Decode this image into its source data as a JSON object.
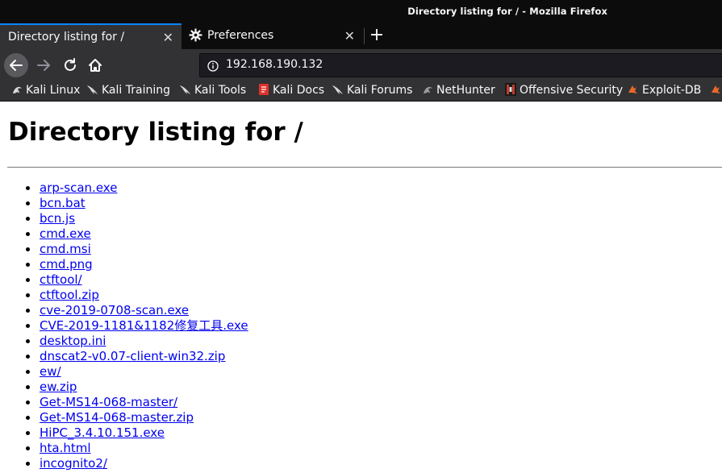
{
  "window": {
    "title": "Directory listing for / - Mozilla Firefox"
  },
  "tabs": [
    {
      "label": "Directory listing for /",
      "active": true
    },
    {
      "label": "Preferences",
      "active": false
    }
  ],
  "navbar": {
    "url": "192.168.190.132"
  },
  "bookmarks": [
    {
      "label": "Kali Linux",
      "icon": "kali-dragon-icon"
    },
    {
      "label": "Kali Training",
      "icon": "kali-dragon-icon"
    },
    {
      "label": "Kali Tools",
      "icon": "kali-dragon-icon"
    },
    {
      "label": "Kali Docs",
      "icon": "kali-docs-icon"
    },
    {
      "label": "Kali Forums",
      "icon": "kali-dragon-icon"
    },
    {
      "label": "NetHunter",
      "icon": "nethunter-icon"
    },
    {
      "label": "Offensive Security",
      "icon": "offsec-icon"
    },
    {
      "label": "Exploit-DB",
      "icon": "exploit-db-icon"
    }
  ],
  "page": {
    "heading": "Directory listing for /",
    "files": [
      "arp-scan.exe",
      "bcn.bat",
      "bcn.js",
      "cmd.exe",
      "cmd.msi",
      "cmd.png",
      "ctftool/",
      "ctftool.zip",
      "cve-2019-0708-scan.exe",
      "CVE-2019-1181&1182修复工具.exe",
      "desktop.ini",
      "dnscat2-v0.07-client-win32.zip",
      "ew/",
      "ew.zip",
      "Get-MS14-068-master/",
      "Get-MS14-068-master.zip",
      "HiPC_3.4.10.151.exe",
      "hta.html",
      "incognito2/"
    ]
  },
  "colors": {
    "tab_accent": "#0a84ff",
    "link": "#0000ee",
    "chrome_dark": "#0c0c0d",
    "chrome": "#323234"
  }
}
